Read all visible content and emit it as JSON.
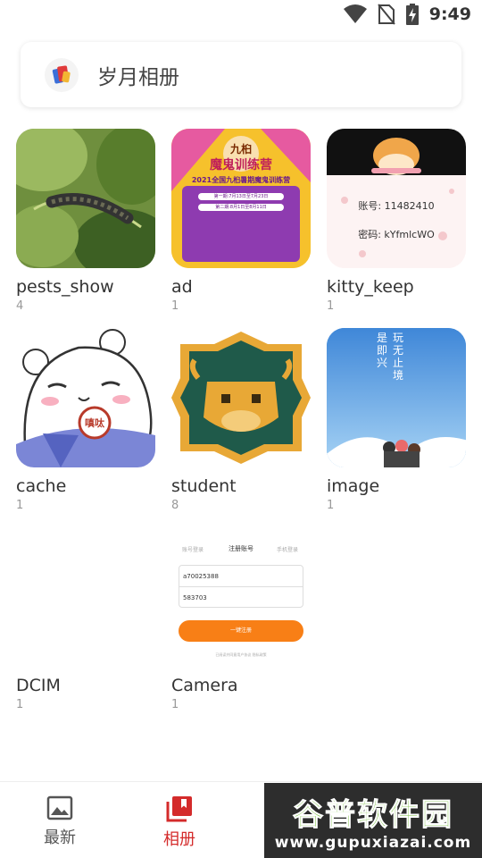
{
  "status_bar": {
    "time": "9:49",
    "icons": [
      "wifi-icon",
      "no-sim-icon",
      "battery-charging-icon"
    ]
  },
  "header": {
    "title": "岁月相册",
    "logo_icon": "photo-album-logo"
  },
  "albums": [
    {
      "name": "pests_show",
      "count": "4"
    },
    {
      "name": "ad",
      "count": "1"
    },
    {
      "name": "kitty_keep",
      "count": "1"
    },
    {
      "name": "cache",
      "count": "1"
    },
    {
      "name": "student",
      "count": "8"
    },
    {
      "name": "image",
      "count": "1"
    },
    {
      "name": "DCIM",
      "count": "1"
    },
    {
      "name": "Camera",
      "count": "1"
    }
  ],
  "thumb_text": {
    "ad": {
      "logo_line1": "九桕",
      "logo_line2": "魔鬼训练营",
      "headline": "2021全国九桕暑期魔鬼训练营",
      "period1": "第一期:7月13日至7月23日",
      "period2": "第二期:8月1日至8月11日"
    },
    "kitty": {
      "account": "账号: 11482410",
      "password": "密码: kYfmlcWO"
    },
    "image": {
      "poem1": "玩无止境",
      "poem2": "是即兴"
    },
    "cache": {
      "badge": "嗔呔"
    },
    "camera": {
      "tab1": "账号登录",
      "tab2": "注册账号",
      "tab3": "手机登录",
      "field1": "a70025388",
      "field2": "583703",
      "button": "一键注册",
      "footer": "已阅读并同意用户协议 隐私政策"
    }
  },
  "bottom_nav": {
    "recent_label": "最新",
    "albums_label": "相册"
  },
  "watermark": {
    "title": "谷普软件园",
    "url": "www.gupuxiazai.com"
  },
  "colors": {
    "accent": "#d42b2b",
    "nav_inactive": "#555555"
  }
}
